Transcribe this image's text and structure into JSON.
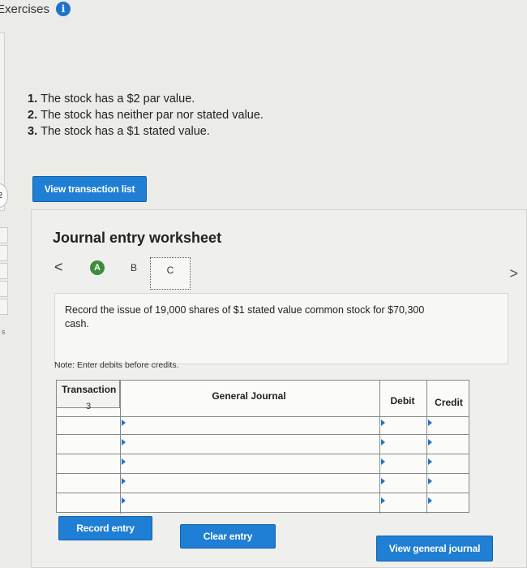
{
  "header": {
    "title": "Exercises",
    "info_icon": "i"
  },
  "side": {
    "step": "2",
    "step_letter": "s"
  },
  "requirements": [
    {
      "num": "1.",
      "text": "The stock has a $2 par value."
    },
    {
      "num": "2.",
      "text": "The stock has neither par nor stated value."
    },
    {
      "num": "3.",
      "text": "The stock has a $1 stated value."
    }
  ],
  "buttons": {
    "view_transaction_list": "View transaction list",
    "record_entry": "Record entry",
    "clear_entry": "Clear entry",
    "view_general_journal": "View general journal"
  },
  "worksheet": {
    "title": "Journal entry worksheet",
    "nav_prev": "<",
    "nav_next": ">",
    "tabs": [
      "A",
      "B",
      "C"
    ],
    "description": "Record the issue of 19,000 shares of $1 stated value common stock for $70,300 cash.",
    "note": "Note: Enter debits before credits."
  },
  "journal": {
    "columns": {
      "transaction": "Transaction",
      "general_journal": "General Journal",
      "debit": "Debit",
      "credit": "Credit"
    },
    "transaction_number": "3"
  },
  "colors": {
    "accent": "#1f7fd4",
    "tab_active": "#3b8c3b",
    "info": "#1e73c9"
  }
}
